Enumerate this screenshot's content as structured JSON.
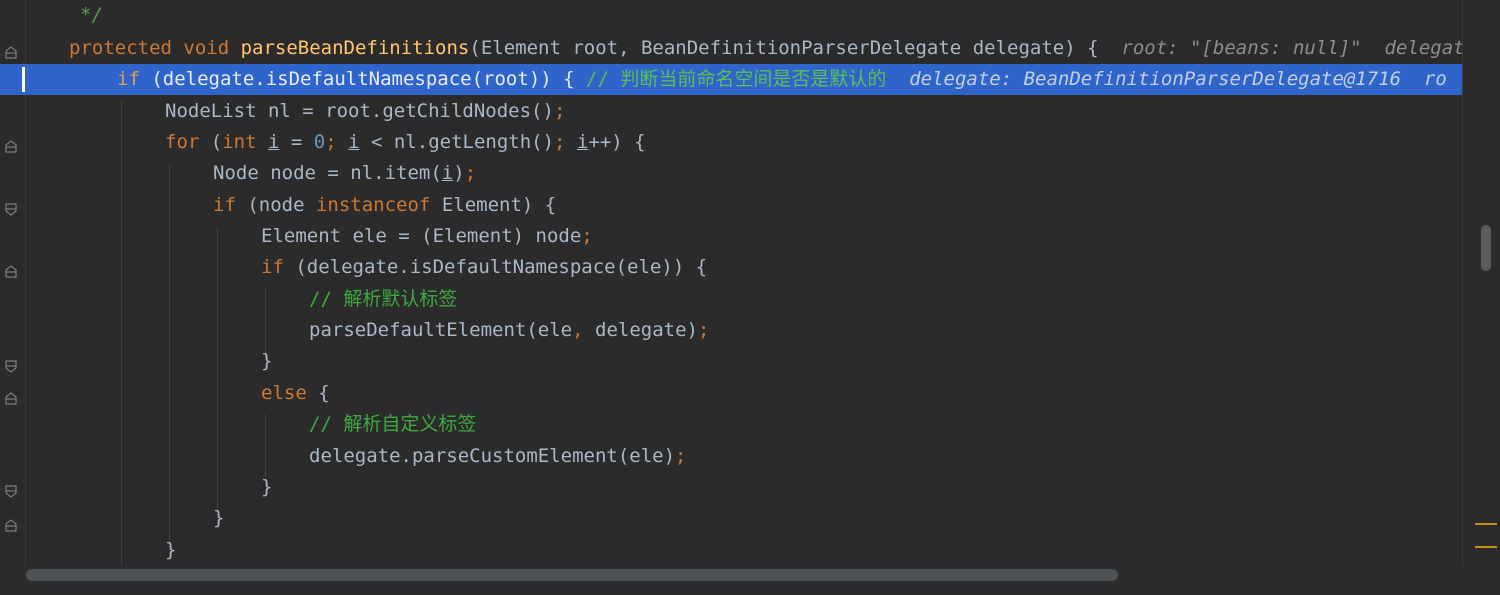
{
  "editor": {
    "language": "java",
    "lines": [
      {
        "tokens": [
          {
            "t": "*/",
            "c": "cm"
          }
        ]
      },
      {
        "tokens": [
          {
            "t": "protected ",
            "c": "kw"
          },
          {
            "t": "void ",
            "c": "kw"
          },
          {
            "t": "parseBeanDefinitions",
            "c": "fn"
          },
          {
            "t": "(Element root, BeanDefinitionParserDelegate delegate) {  ",
            "c": "pl"
          },
          {
            "t": "root: \"[beans: null]\"  delegate: Bea",
            "c": "hint"
          }
        ]
      },
      {
        "tokens": [
          {
            "t": "if ",
            "c": "kw"
          },
          {
            "t": "(delegate.isDefaultNamespace(root)) { ",
            "c": "pl"
          },
          {
            "t": "// 判断当前命名空间是否是默认的  ",
            "c": "cmtzh"
          },
          {
            "t": "delegate: BeanDefinitionParserDelegate@1716  ro",
            "c": "hint"
          }
        ]
      },
      {
        "tokens": [
          {
            "t": "NodeList nl = root.getChildNodes()",
            "c": "pl"
          },
          {
            "t": ";",
            "c": "kw"
          }
        ]
      },
      {
        "tokens": [
          {
            "t": "for ",
            "c": "kw"
          },
          {
            "t": "(",
            "c": "pl"
          },
          {
            "t": "int ",
            "c": "kw"
          },
          {
            "t": "i",
            "c": "pl ul"
          },
          {
            "t": " = ",
            "c": "pl"
          },
          {
            "t": "0",
            "c": "num"
          },
          {
            "t": "; ",
            "c": "kw"
          },
          {
            "t": "i",
            "c": "pl ul"
          },
          {
            "t": " < nl.getLength()",
            "c": "pl"
          },
          {
            "t": "; ",
            "c": "kw"
          },
          {
            "t": "i",
            "c": "pl ul"
          },
          {
            "t": "++) {",
            "c": "pl"
          }
        ]
      },
      {
        "tokens": [
          {
            "t": "Node node = nl.item(",
            "c": "pl"
          },
          {
            "t": "i",
            "c": "pl ul"
          },
          {
            "t": ")",
            "c": "pl"
          },
          {
            "t": ";",
            "c": "kw"
          }
        ]
      },
      {
        "tokens": [
          {
            "t": "if ",
            "c": "kw"
          },
          {
            "t": "(node ",
            "c": "pl"
          },
          {
            "t": "instanceof ",
            "c": "kw"
          },
          {
            "t": "Element) {",
            "c": "pl"
          }
        ]
      },
      {
        "tokens": [
          {
            "t": "Element ele = (Element) node",
            "c": "pl"
          },
          {
            "t": ";",
            "c": "kw"
          }
        ]
      },
      {
        "tokens": [
          {
            "t": "if ",
            "c": "kw"
          },
          {
            "t": "(delegate.isDefaultNamespace(ele)) {",
            "c": "pl"
          }
        ]
      },
      {
        "tokens": [
          {
            "t": "// 解析默认标签",
            "c": "cmtzh"
          }
        ]
      },
      {
        "tokens": [
          {
            "t": "parseDefaultElement(ele",
            "c": "pl"
          },
          {
            "t": ", ",
            "c": "kw"
          },
          {
            "t": "delegate)",
            "c": "pl"
          },
          {
            "t": ";",
            "c": "kw"
          }
        ]
      },
      {
        "tokens": [
          {
            "t": "}",
            "c": "pl"
          }
        ]
      },
      {
        "tokens": [
          {
            "t": "else ",
            "c": "kw"
          },
          {
            "t": "{",
            "c": "pl"
          }
        ]
      },
      {
        "tokens": [
          {
            "t": "// 解析自定义标签",
            "c": "cmtzh"
          }
        ]
      },
      {
        "tokens": [
          {
            "t": "delegate.parseCustomElement(ele)",
            "c": "pl"
          },
          {
            "t": ";",
            "c": "kw"
          }
        ]
      },
      {
        "tokens": [
          {
            "t": "}",
            "c": "pl"
          }
        ]
      },
      {
        "tokens": [
          {
            "t": "}",
            "c": "pl"
          }
        ]
      },
      {
        "tokens": [
          {
            "t": "}",
            "c": "pl"
          }
        ]
      }
    ]
  },
  "colors": {
    "background": "#2b2b2b",
    "current_line": "#2f65ca",
    "keyword": "#cc7832",
    "function": "#ffc66d",
    "comment": "#629755",
    "number": "#6897bb",
    "text": "#a9b7c6"
  }
}
